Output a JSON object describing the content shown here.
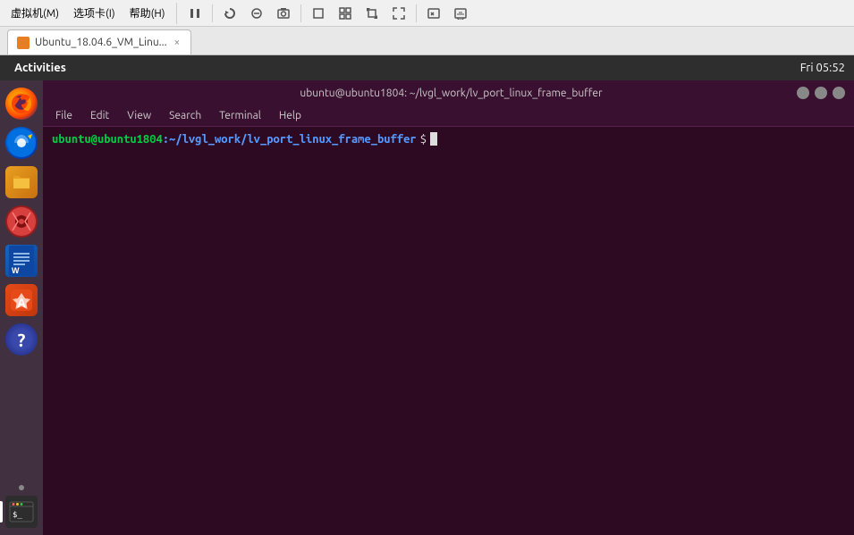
{
  "vbox_menu": {
    "items": [
      "虚拟机(M)",
      "选项卡(I)",
      "帮助(H)"
    ]
  },
  "vbox_toolbar": {
    "buttons": [
      "⏸",
      "🖥",
      "🔄",
      "📥",
      "📤",
      "⬜",
      "⬜",
      "⬜",
      "⬜",
      "⬛",
      "⬜",
      "⬜"
    ]
  },
  "tab": {
    "label": "Ubuntu_18.04.6_VM_Linu...",
    "close": "×"
  },
  "gnome": {
    "activities": "Activities",
    "clock": "Fri 05:52"
  },
  "terminal": {
    "title": "ubuntu@ubuntu1804: ~/lvgl_work/lv_port_linux_frame_buffer",
    "menu": {
      "file": "File",
      "edit": "Edit",
      "view": "View",
      "search": "Search",
      "terminal": "Terminal",
      "help": "Help"
    },
    "prompt_user_host": "ubuntu@ubuntu1804",
    "prompt_path": ":~/lvgl_work/lv_port_linux_frame_buffer",
    "prompt_dollar": "$"
  },
  "sidebar": {
    "icons": [
      {
        "name": "firefox",
        "label": "Firefox"
      },
      {
        "name": "thunderbird",
        "label": "Thunderbird"
      },
      {
        "name": "files",
        "label": "Files"
      },
      {
        "name": "rhythmbox",
        "label": "Rhythmbox"
      },
      {
        "name": "writer",
        "label": "LibreOffice Writer"
      },
      {
        "name": "appcenter",
        "label": "App Center"
      },
      {
        "name": "help",
        "label": "Help"
      },
      {
        "name": "terminal",
        "label": "Terminal"
      }
    ]
  }
}
